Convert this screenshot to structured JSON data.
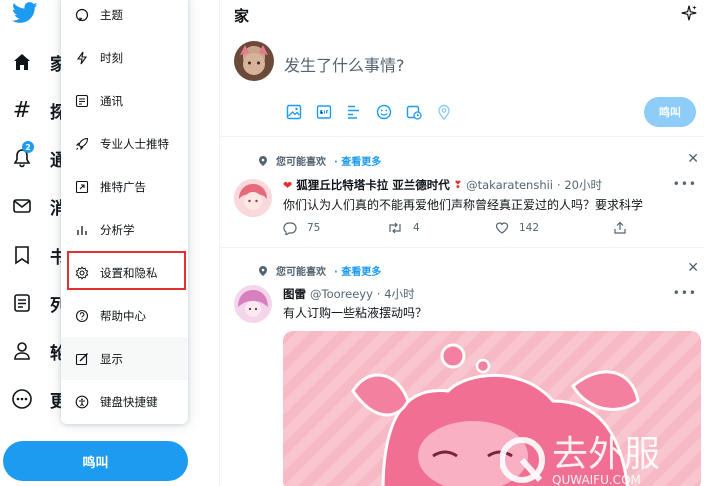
{
  "sidebar": {
    "nav": [
      {
        "label": "家",
        "icon": "home-icon"
      },
      {
        "label": "探",
        "icon": "hashtag-icon"
      },
      {
        "label": "通",
        "icon": "bell-icon",
        "badge": "2"
      },
      {
        "label": "消",
        "icon": "mail-icon"
      },
      {
        "label": "书",
        "icon": "bookmark-icon"
      },
      {
        "label": "列",
        "icon": "list-icon"
      },
      {
        "label": "轮",
        "icon": "profile-icon"
      },
      {
        "label": "更",
        "icon": "more-icon"
      }
    ],
    "tweet_button": "鸣叫"
  },
  "menu": {
    "items": [
      {
        "label": "主题",
        "icon": "topic-icon"
      },
      {
        "label": "时刻",
        "icon": "lightning-icon"
      },
      {
        "label": "通讯",
        "icon": "newsletter-icon"
      },
      {
        "label": "专业人士推特",
        "icon": "rocket-icon"
      },
      {
        "label": "推特广告",
        "icon": "ads-icon"
      },
      {
        "label": "分析学",
        "icon": "analytics-icon"
      },
      {
        "label": "设置和隐私",
        "icon": "gear-icon"
      },
      {
        "label": "帮助中心",
        "icon": "help-icon"
      },
      {
        "label": "显示",
        "icon": "display-icon"
      },
      {
        "label": "键盘快捷键",
        "icon": "accessibility-icon"
      }
    ]
  },
  "main": {
    "title": "家",
    "compose": {
      "placeholder": "发生了什么事情?",
      "button": "鸣叫"
    },
    "tweets": [
      {
        "suggest": "您可能喜欢",
        "more": "· 查看更多",
        "name": "狐狸丘比特塔卡拉 亚兰德时代",
        "handle": "@takaratenshii",
        "time": "· 20小时",
        "text": "你们认为人们真的不能再爱他们声称曾经真正爱过的人吗？要求科学",
        "replies": "75",
        "retweets": "4",
        "likes": "142"
      },
      {
        "suggest": "您可能喜欢",
        "more": "· 查看更多",
        "name": "图雷",
        "handle": "@Tooreeyy",
        "time": "· 4小时",
        "text": "有人订购一些粘液摆动吗？"
      }
    ]
  },
  "watermark": {
    "main": "去外服",
    "sub": "QUWAIFU.COM"
  },
  "colors": {
    "accent": "#1d9bf0",
    "highlight": "#e0302f"
  }
}
